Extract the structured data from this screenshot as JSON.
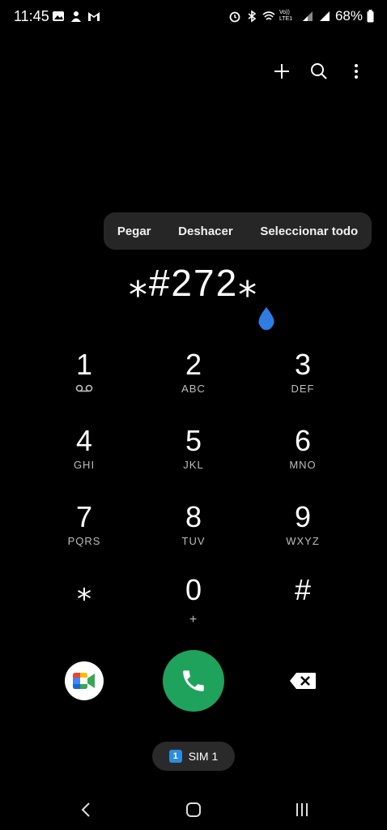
{
  "status": {
    "time": "11:45",
    "battery": "68%",
    "left_icons": [
      "gallery-icon",
      "user-icon",
      "gmail-icon"
    ],
    "right_icons": [
      "alarm-icon",
      "bluetooth-icon",
      "wifi-icon",
      "volte-icon",
      "signal-icon"
    ],
    "volte_label": "Vo)) LTE1"
  },
  "toolbar": {
    "icons": [
      "plus-icon",
      "search-icon",
      "more-vert-icon"
    ]
  },
  "context_menu": {
    "paste": "Pegar",
    "undo": "Deshacer",
    "select_all": "Seleccionar todo"
  },
  "dialer": {
    "number": "⁎#272⁎",
    "keys": [
      {
        "digit": "1",
        "letters": "",
        "icon": "voicemail-icon"
      },
      {
        "digit": "2",
        "letters": "ABC"
      },
      {
        "digit": "3",
        "letters": "DEF"
      },
      {
        "digit": "4",
        "letters": "GHI"
      },
      {
        "digit": "5",
        "letters": "JKL"
      },
      {
        "digit": "6",
        "letters": "MNO"
      },
      {
        "digit": "7",
        "letters": "PQRS"
      },
      {
        "digit": "8",
        "letters": "TUV"
      },
      {
        "digit": "9",
        "letters": "WXYZ"
      },
      {
        "digit": "⁎",
        "letters": ""
      },
      {
        "digit": "0",
        "letters": "+"
      },
      {
        "digit": "#",
        "letters": ""
      }
    ]
  },
  "actions": {
    "video_app": "meet-icon",
    "call": "phone-icon",
    "delete": "backspace-icon"
  },
  "sim": {
    "badge": "1",
    "label": "SIM 1"
  },
  "colors": {
    "call_green": "#1fa35c",
    "drop_blue": "#2f7de1",
    "sim_blue": "#2b8de0"
  }
}
